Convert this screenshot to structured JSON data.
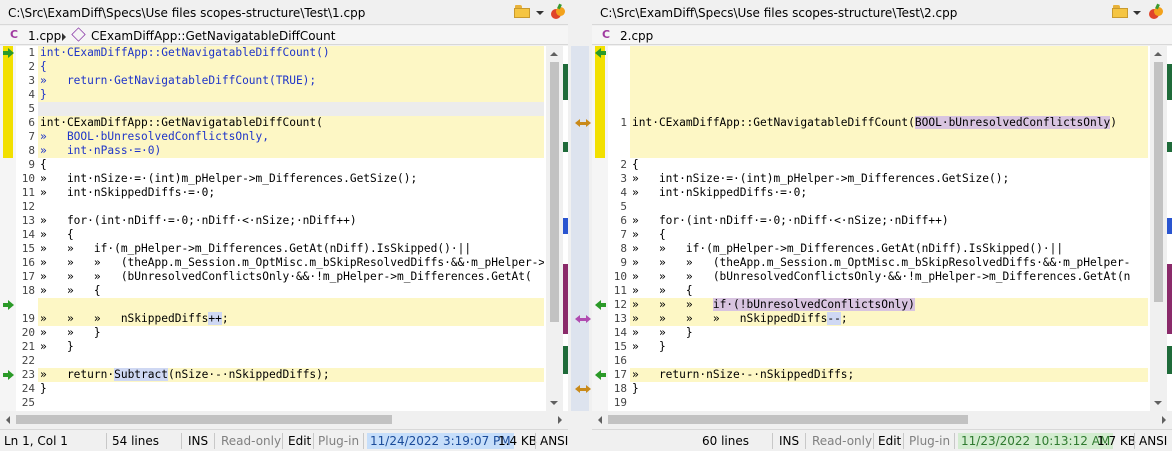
{
  "colors": {
    "changed_bg": "#fdf7c5",
    "blue_bg": "#dfe4f0",
    "change_bar": "#f2e000",
    "arrow_green": "#2b9a28",
    "link_orange": "#c98a1a",
    "link_purple": "#b04bb0"
  },
  "left": {
    "path": "C:\\Src\\ExamDiff\\Specs\\Use files scopes-structure\\Test\\1.cpp",
    "file": "1.cpp",
    "function": "CExamDiffApp::GetNavigatableDiffCount",
    "status": {
      "position": "Ln 1, Col 1",
      "lines": "54 lines",
      "mode": "INS",
      "readonly": "Read-only",
      "edit": "Edit",
      "plugin": "Plug-in",
      "date": "11/24/2022 3:19:07 PM",
      "size": "1.4 KB",
      "encoding": "ANSI"
    },
    "lines": [
      {
        "n": "1",
        "text": "int·CExamDiffApp::GetNavigatableDiffCount()"
      },
      {
        "n": "2",
        "text": "{"
      },
      {
        "n": "3",
        "text": "»   return·GetNavigatableDiffCount(TRUE);"
      },
      {
        "n": "4",
        "text": "}"
      },
      {
        "n": "5",
        "text": ""
      },
      {
        "n": "6",
        "text": "int·CExamDiffApp::GetNavigatableDiffCount("
      },
      {
        "n": "7",
        "text": "»   BOOL·bUnresolvedConflictsOnly,"
      },
      {
        "n": "8",
        "text": "»   int·nPass·=·0)"
      },
      {
        "n": "9",
        "text": "{"
      },
      {
        "n": "10",
        "text": "»   int·nSize·=·(int)m_pHelper->m_Differences.GetSize();"
      },
      {
        "n": "11",
        "text": "»   int·nSkippedDiffs·=·0;"
      },
      {
        "n": "12",
        "text": ""
      },
      {
        "n": "13",
        "text": "»   for·(int·nDiff·=·0;·nDiff·<·nSize;·nDiff++)"
      },
      {
        "n": "14",
        "text": "»   {"
      },
      {
        "n": "15",
        "text": "»   »   if·(m_pHelper->m_Differences.GetAt(nDiff).IsSkipped()·||"
      },
      {
        "n": "16",
        "text": "»   »   »   (theApp.m_Session.m_OptMisc.m_bSkipResolvedDiffs·&&·m_pHelper->"
      },
      {
        "n": "17",
        "text": "»   »   »   (bUnresolvedConflictsOnly·&&·!m_pHelper->m_Differences.GetAt("
      },
      {
        "n": "18",
        "text": "»   »   {"
      },
      {
        "n": "19",
        "text": "»   »   »   nSkippedDiffs++;"
      },
      {
        "n": "20",
        "text": "»   »   }"
      },
      {
        "n": "21",
        "text": "»   }"
      },
      {
        "n": "22",
        "text": ""
      },
      {
        "n": "23",
        "text": "»   return·Subtract(nSize·-·nSkippedDiffs);"
      },
      {
        "n": "24",
        "text": "}"
      },
      {
        "n": "25",
        "text": ""
      }
    ]
  },
  "right": {
    "path": "C:\\Src\\ExamDiff\\Specs\\Use files scopes-structure\\Test\\2.cpp",
    "file": "2.cpp",
    "status": {
      "lines": "60 lines",
      "mode": "INS",
      "readonly": "Read-only",
      "edit": "Edit",
      "plugin": "Plug-in",
      "date": "11/23/2022 10:13:12 AM",
      "size": "1.7 KB",
      "encoding": "ANSI"
    },
    "lines": [
      {
        "n": "1",
        "text": "int·CExamDiffApp::GetNavigatableDiffCount(BOOL·bUnresolvedConflictsOnly)"
      },
      {
        "n": "2",
        "text": "{"
      },
      {
        "n": "3",
        "text": "»   int·nSize·=·(int)m_pHelper->m_Differences.GetSize();"
      },
      {
        "n": "4",
        "text": "»   int·nSkippedDiffs·=·0;"
      },
      {
        "n": "5",
        "text": ""
      },
      {
        "n": "6",
        "text": "»   for·(int·nDiff·=·0;·nDiff·<·nSize;·nDiff++)"
      },
      {
        "n": "7",
        "text": "»   {"
      },
      {
        "n": "8",
        "text": "»   »   if·(m_pHelper->m_Differences.GetAt(nDiff).IsSkipped()·||"
      },
      {
        "n": "9",
        "text": "»   »   »   (theApp.m_Session.m_OptMisc.m_bSkipResolvedDiffs·&&·m_pHelper-"
      },
      {
        "n": "10",
        "text": "»   »   »   (bUnresolvedConflictsOnly·&&·!m_pHelper->m_Differences.GetAt(n"
      },
      {
        "n": "11",
        "text": "»   »   {"
      },
      {
        "n": "12",
        "text": "»   »   »   if·(!bUnresolvedConflictsOnly)"
      },
      {
        "n": "13",
        "text": "»   »   »   »   nSkippedDiffs--;"
      },
      {
        "n": "14",
        "text": "»   »   }"
      },
      {
        "n": "15",
        "text": "»   }"
      },
      {
        "n": "16",
        "text": ""
      },
      {
        "n": "17",
        "text": "»   return·nSize·-·nSkippedDiffs;"
      },
      {
        "n": "18",
        "text": "}"
      },
      {
        "n": "19",
        "text": ""
      }
    ]
  }
}
